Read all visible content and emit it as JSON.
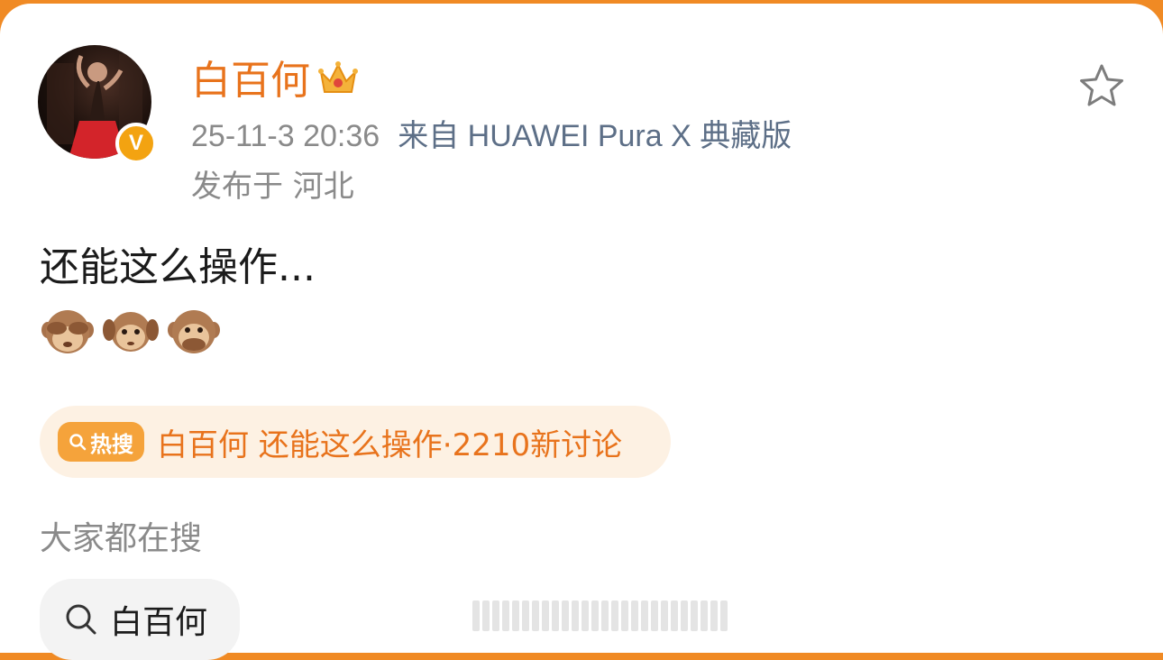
{
  "post": {
    "username": "白百何",
    "timestamp": "25-11-3 20:36",
    "source": "来自 HUAWEI Pura X 典藏版",
    "location": "发布于 河北",
    "text": "还能这么操作...",
    "emojis": [
      "see-no-evil-monkey",
      "hear-no-evil-monkey",
      "speak-no-evil-monkey"
    ],
    "verified_badge": "V"
  },
  "trend": {
    "tag_label": "热搜",
    "text": "白百何 还能这么操作·2210新讨论"
  },
  "search": {
    "section_title": "大家都在搜",
    "chip_label": "白百何"
  },
  "colors": {
    "accent": "#e8731c",
    "header_bar": "#f08a24",
    "trend_bg": "#fdf1e3",
    "verified": "#f3a311"
  },
  "icons": {
    "favorite": "star-outline-icon",
    "crown": "crown-icon",
    "search": "search-icon"
  }
}
